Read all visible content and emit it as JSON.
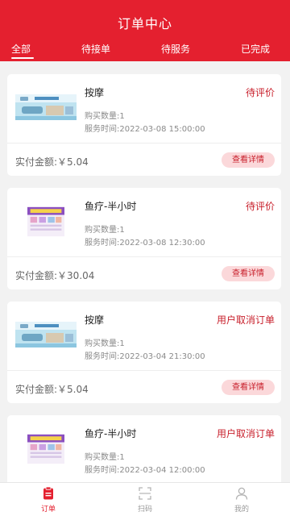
{
  "header": {
    "title": "订单中心",
    "tabs": [
      {
        "label": "全部"
      },
      {
        "label": "待接单"
      },
      {
        "label": "待服务"
      },
      {
        "label": "已完成"
      }
    ]
  },
  "orders": [
    {
      "service": "按摩",
      "status": "待评价",
      "qty_text": "购买数量:1",
      "time_text": "服务时间:2022-03-08 15:00:00",
      "amount_text": "实付金额:￥5.04",
      "button": "查看详情",
      "thumb": "massage-banner"
    },
    {
      "service": "鱼疗-半小时",
      "status": "待评价",
      "qty_text": "购买数量:1",
      "time_text": "服务时间:2022-03-08 12:30:00",
      "amount_text": "实付金额:￥30.04",
      "button": "查看详情",
      "thumb": "fish-therapy-poster"
    },
    {
      "service": "按摩",
      "status": "用户取消订单",
      "qty_text": "购买数量:1",
      "time_text": "服务时间:2022-03-04 21:30:00",
      "amount_text": "实付金额:￥5.04",
      "button": "查看详情",
      "thumb": "massage-banner"
    },
    {
      "service": "鱼疗-半小时",
      "status": "用户取消订单",
      "qty_text": "购买数量:1",
      "time_text": "服务时间:2022-03-04 12:00:00",
      "amount_text": "",
      "button": "",
      "thumb": "fish-therapy-poster"
    }
  ],
  "bottom_nav": [
    {
      "label": "订单",
      "icon": "order-icon",
      "active": true
    },
    {
      "label": "扫码",
      "icon": "scan-icon",
      "active": false
    },
    {
      "label": "我的",
      "icon": "profile-icon",
      "active": false
    }
  ],
  "colors": {
    "brand": "#e4202f",
    "status": "#c8202c",
    "button_bg": "#fbd8da"
  }
}
